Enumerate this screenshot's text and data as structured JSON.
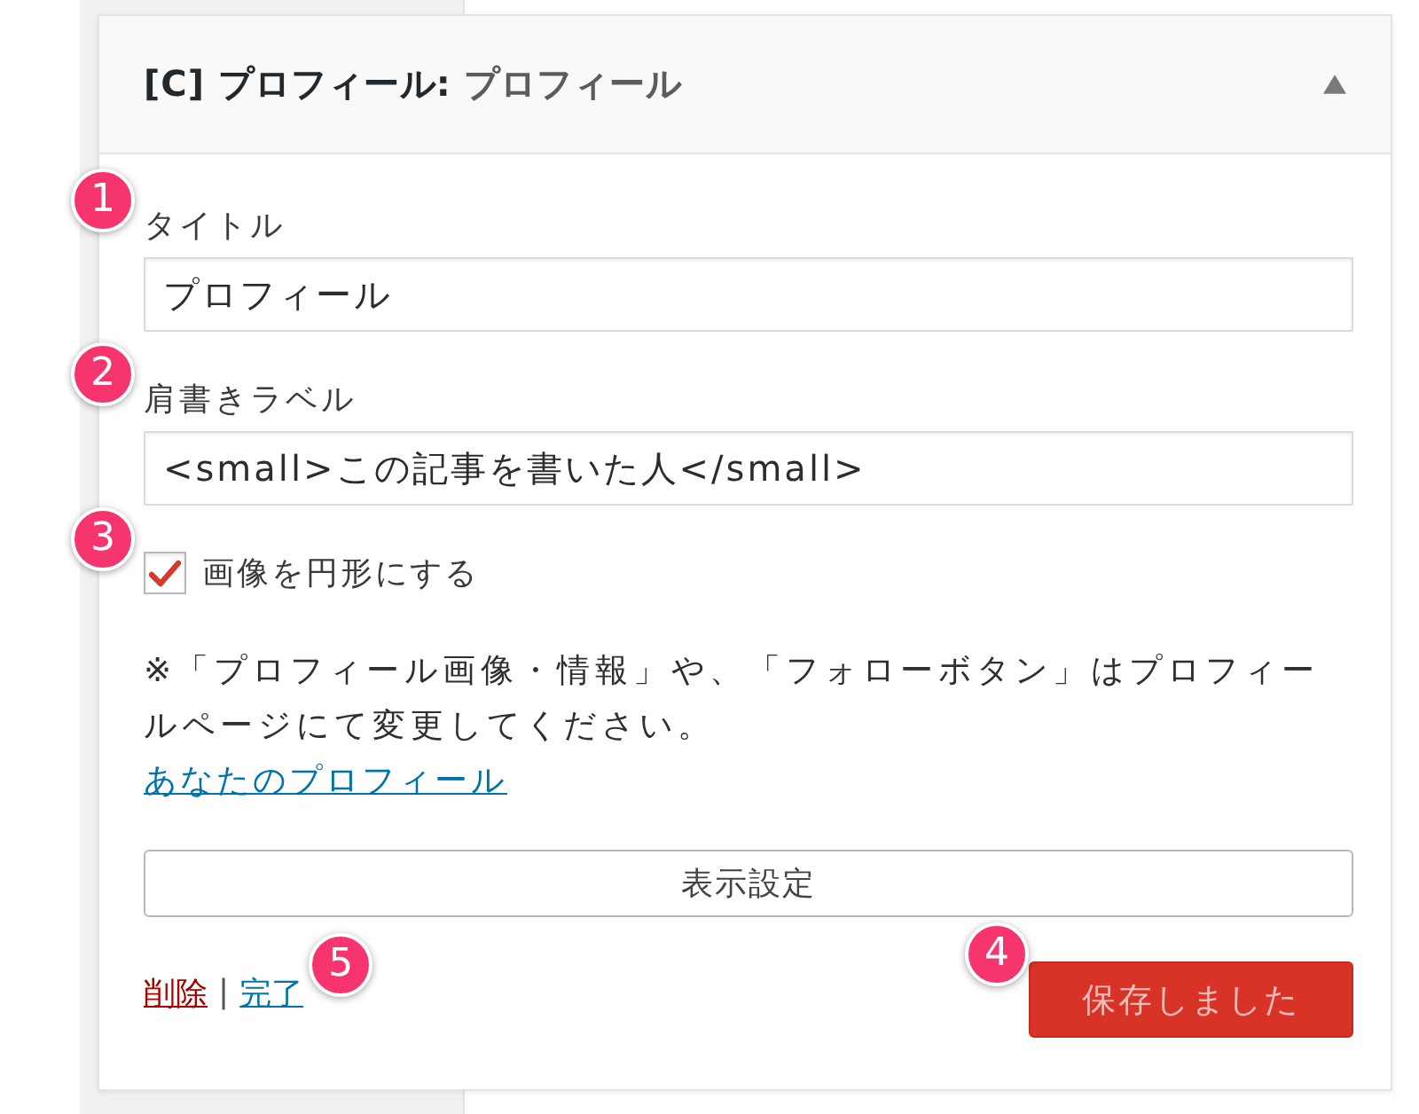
{
  "widget": {
    "title": "[C] プロフィール:",
    "subtitle": "プロフィール",
    "expanded": true
  },
  "fields": [
    {
      "label": "タイトル",
      "value": "プロフィール",
      "marker": "1"
    },
    {
      "label": "肩書きラベル",
      "value": "<small>この記事を書いた人</small>",
      "marker": "2"
    }
  ],
  "checkbox": {
    "label": "画像を円形にする",
    "checked": true,
    "marker": "3"
  },
  "note": "※「プロフィール画像・情報」や、「フォローボタン」はプロフィールページにて変更してください。",
  "profile_link": "あなたのプロフィール",
  "display_button": "表示設定",
  "footer": {
    "delete_link": "削除",
    "separator": "|",
    "done_link": "完了",
    "done_marker": "5",
    "save_button": "保存しました",
    "save_disabled": true,
    "save_marker": "4"
  }
}
